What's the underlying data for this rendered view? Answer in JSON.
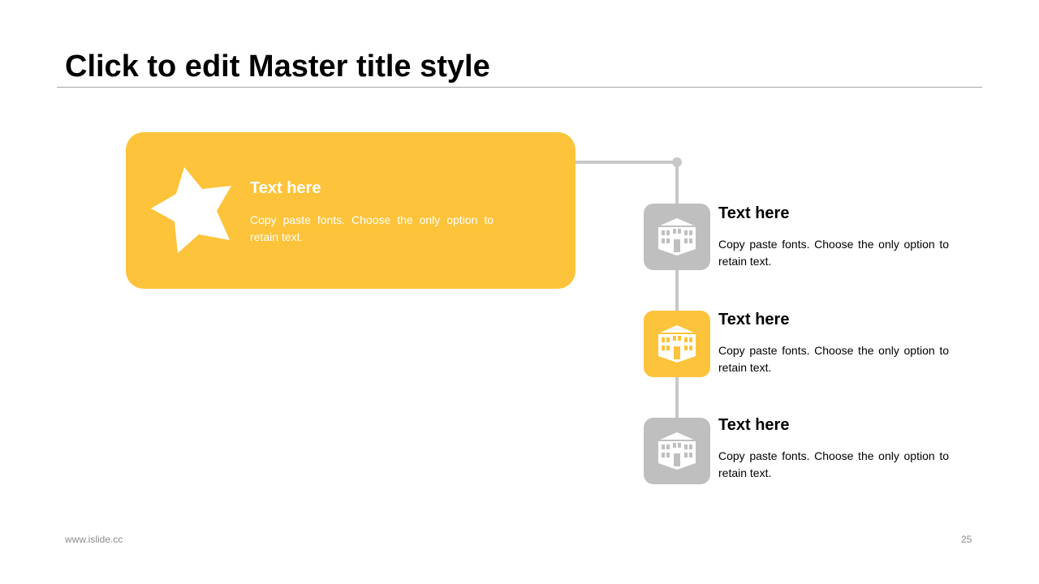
{
  "slide": {
    "title": "Click to edit Master title style",
    "footer_url": "www.islide.cc",
    "page_number": "25"
  },
  "colors": {
    "accent": "#fdc33a",
    "muted": "#bfbfbf",
    "connector": "#c8c8c8"
  },
  "hero": {
    "icon": "star-icon",
    "heading": "Text here",
    "body": "Copy paste fonts. Choose the only option to retain text."
  },
  "items": [
    {
      "icon": "building-icon",
      "highlighted": false,
      "heading": "Text here",
      "body": "Copy paste fonts. Choose the only option to retain text."
    },
    {
      "icon": "building-icon",
      "highlighted": true,
      "heading": "Text here",
      "body": "Copy paste fonts. Choose the only option to retain text."
    },
    {
      "icon": "building-icon",
      "highlighted": false,
      "heading": "Text here",
      "body": "Copy paste fonts. Choose the only option to retain text."
    }
  ]
}
